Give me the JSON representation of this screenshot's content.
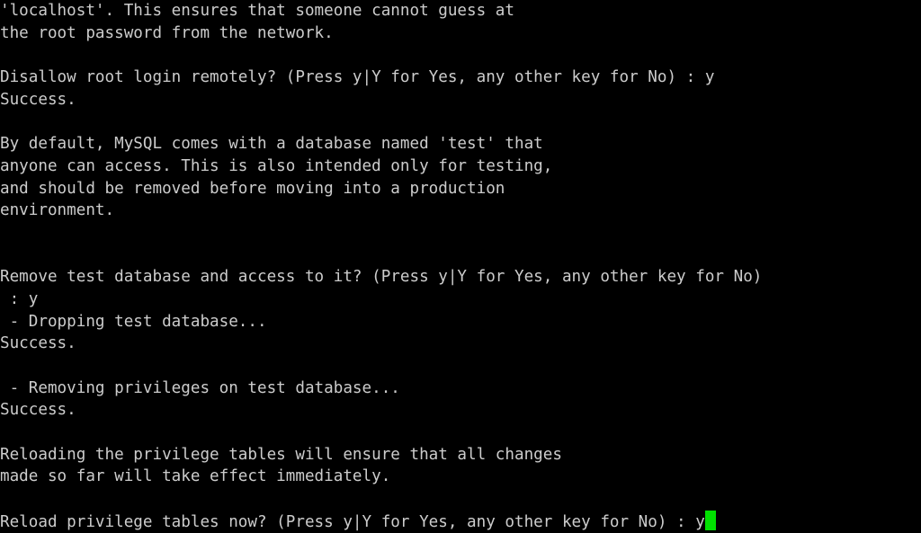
{
  "terminal": {
    "kind": "mysql-secure-installation-console",
    "background_color": "#000000",
    "foreground_color": "#cccccc",
    "cursor_color": "#00e000",
    "columns": 82,
    "rows": 24,
    "lines": [
      "'localhost'. This ensures that someone cannot guess at",
      "the root password from the network.",
      "",
      "Disallow root login remotely? (Press y|Y for Yes, any other key for No) : y",
      "Success.",
      "",
      "By default, MySQL comes with a database named 'test' that",
      "anyone can access. This is also intended only for testing,",
      "and should be removed before moving into a production",
      "environment.",
      "",
      "",
      "Remove test database and access to it? (Press y|Y for Yes, any other key for No)",
      " : y",
      " - Dropping test database...",
      "Success.",
      "",
      " - Removing privileges on test database...",
      "Success.",
      "",
      "Reloading the privilege tables will ensure that all changes",
      "made so far will take effect immediately.",
      "",
      "Reload privilege tables now? (Press y|Y for Yes, any other key for No) : y"
    ],
    "cursor": {
      "row": 24,
      "column": 74,
      "shape": "block",
      "visible": true
    }
  }
}
